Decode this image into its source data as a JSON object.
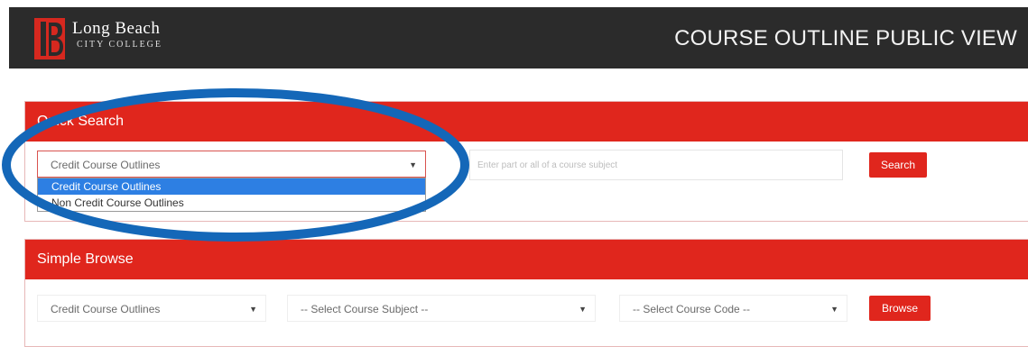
{
  "header": {
    "logo_line1": "Long Beach",
    "logo_line2": "CITY COLLEGE",
    "title": "COURSE OUTLINE PUBLIC VIEW"
  },
  "quick_search": {
    "heading": "Quick Search",
    "type_select": {
      "value": "Credit Course Outlines",
      "options": [
        "Credit Course Outlines",
        "Non Credit Course Outlines"
      ],
      "highlighted_option": "Credit Course Outlines"
    },
    "search_placeholder": "Enter part or all of a course subject",
    "search_button": "Search"
  },
  "simple_browse": {
    "heading": "Simple Browse",
    "type_select": {
      "value": "Credit Course Outlines"
    },
    "subject_select": {
      "value": "-- Select Course Subject --"
    },
    "code_select": {
      "value": "-- Select Course Code --"
    },
    "browse_button": "Browse"
  },
  "colors": {
    "header_bg": "#2b2b2b",
    "accent_red": "#e0261d",
    "highlight_blue": "#2d7fe3",
    "annotation_ring": "#1467b8"
  },
  "icons": {
    "logo": "lbcc-logo-icon",
    "chevron": "chevron-down-icon",
    "annotation": "highlight-ellipse"
  }
}
